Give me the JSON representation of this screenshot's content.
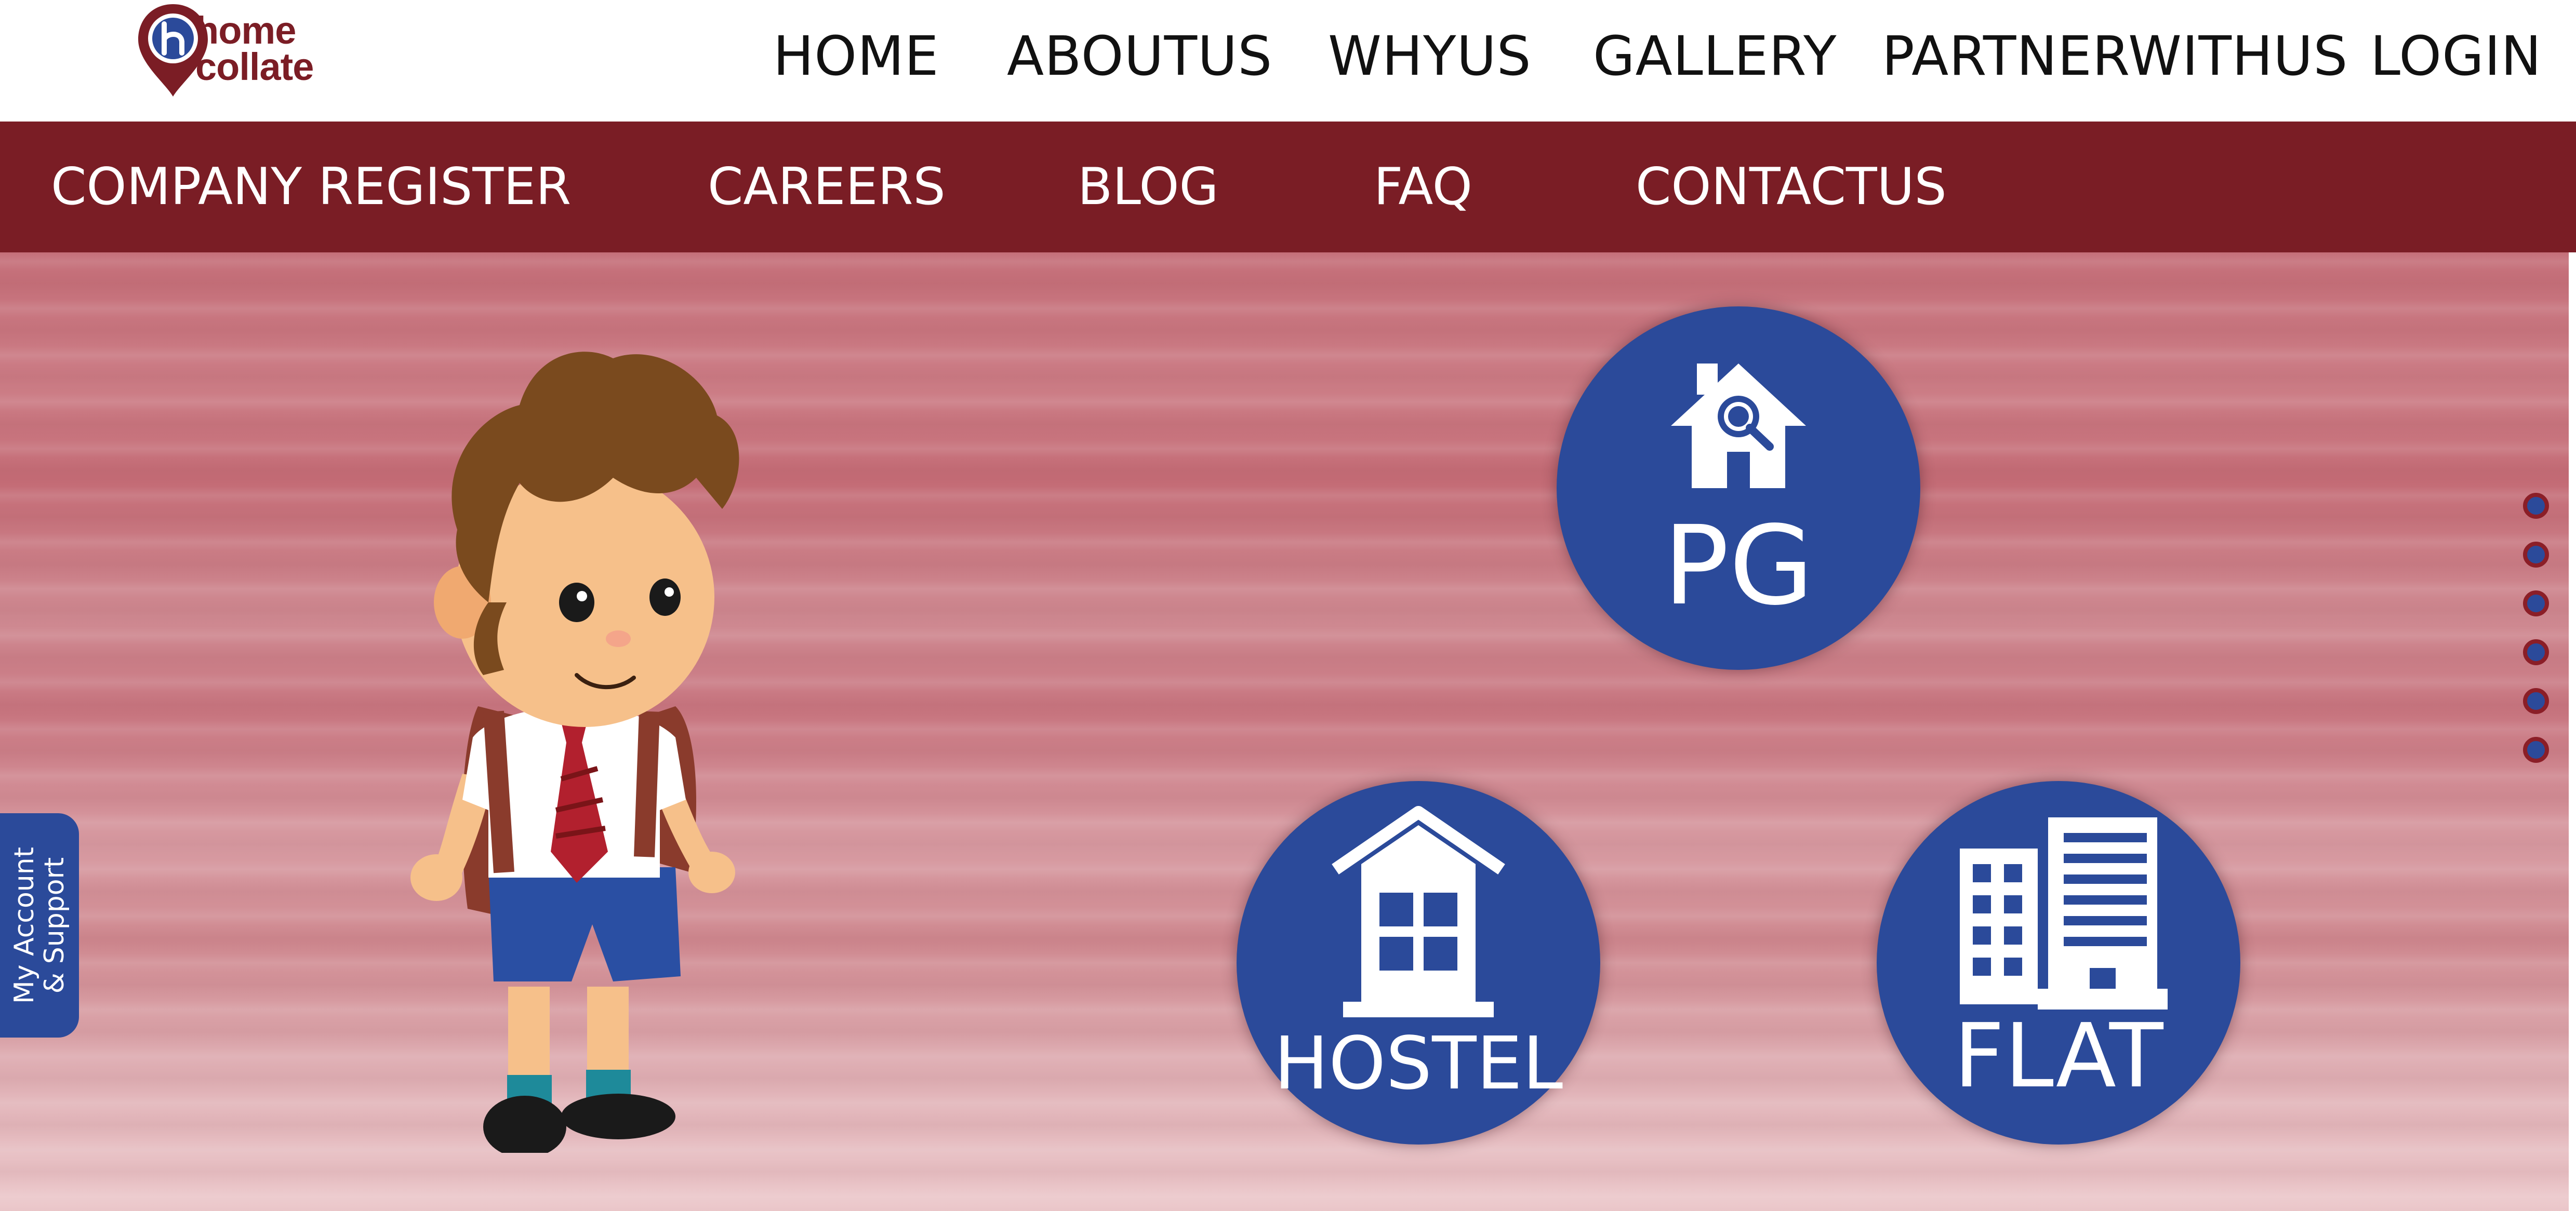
{
  "brand": {
    "line1": "home",
    "line2": "collate",
    "icon": "location-pin-h-logo"
  },
  "main_nav": [
    {
      "label": "HOME"
    },
    {
      "label": "ABOUTUS"
    },
    {
      "label": "WHYUS"
    },
    {
      "label": "GALLERY"
    },
    {
      "label": "PARTNERWITHUS"
    },
    {
      "label": "LOGIN"
    }
  ],
  "sub_nav": [
    {
      "label": "COMPANY REGISTER"
    },
    {
      "label": "CAREERS"
    },
    {
      "label": "BLOG"
    },
    {
      "label": "FAQ"
    },
    {
      "label": "CONTACTUS"
    }
  ],
  "categories": [
    {
      "label": "PG",
      "icon": "house-search-icon"
    },
    {
      "label": "HOSTEL",
      "icon": "building-house-icon"
    },
    {
      "label": "FLAT",
      "icon": "apartment-building-icon"
    }
  ],
  "slider": {
    "dot_count": 6
  },
  "support_tab": {
    "line1": "My Account",
    "line2": "& Support"
  },
  "colors": {
    "maroon": "#7a1d25",
    "blue": "#2b4a9a",
    "hero_pink": "#c8767f"
  }
}
